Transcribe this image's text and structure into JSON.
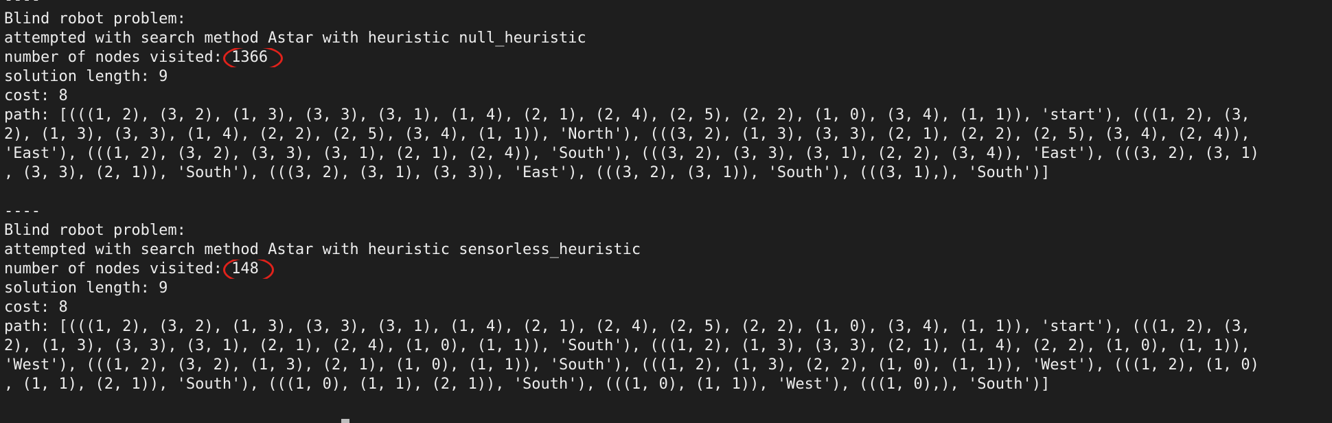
{
  "terminal": {
    "block1": {
      "separator": "----",
      "title": "Blind robot problem:",
      "method_line": "attempted with search method Astar with heuristic null_heuristic",
      "nodes_label": "number of nodes visited: ",
      "nodes_value": "1366",
      "solution_length": "solution length: 9",
      "cost": "cost: 8",
      "path_lines": [
        "path: [(((1, 2), (3, 2), (1, 3), (3, 3), (3, 1), (1, 4), (2, 1), (2, 4), (2, 5), (2, 2), (1, 0), (3, 4), (1, 1)), 'start'), (((1, 2), (3,",
        "2), (1, 3), (3, 3), (1, 4), (2, 2), (2, 5), (3, 4), (1, 1)), 'North'), (((3, 2), (1, 3), (3, 3), (2, 1), (2, 2), (2, 5), (3, 4), (2, 4)),",
        "'East'), (((1, 2), (3, 2), (3, 3), (3, 1), (2, 1), (2, 4)), 'South'), (((3, 2), (3, 3), (3, 1), (2, 2), (3, 4)), 'East'), (((3, 2), (3, 1)",
        ", (3, 3), (2, 1)), 'South'), (((3, 2), (3, 1), (3, 3)), 'East'), (((3, 2), (3, 1)), 'South'), (((3, 1),), 'South')]"
      ]
    },
    "block2": {
      "separator": "----",
      "title": "Blind robot problem:",
      "method_line": "attempted with search method Astar with heuristic sensorless_heuristic",
      "nodes_label": "number of nodes visited: ",
      "nodes_value": "148",
      "solution_length": "solution length: 9",
      "cost": "cost: 8",
      "path_lines": [
        "path: [(((1, 2), (3, 2), (1, 3), (3, 3), (3, 1), (1, 4), (2, 1), (2, 4), (2, 5), (2, 2), (1, 0), (3, 4), (1, 1)), 'start'), (((1, 2), (3,",
        "2), (1, 3), (3, 3), (3, 1), (2, 1), (2, 4), (1, 0), (1, 1)), 'South'), (((1, 2), (1, 3), (3, 3), (2, 1), (1, 4), (2, 2), (1, 0), (1, 1)),",
        "'West'), (((1, 2), (3, 2), (1, 3), (2, 1), (1, 0), (1, 1)), 'South'), (((1, 2), (1, 3), (2, 2), (1, 0), (1, 1)), 'West'), (((1, 2), (1, 0)",
        ", (1, 1), (2, 1)), 'South'), (((1, 0), (1, 1), (2, 1)), 'South'), (((1, 0), (1, 1)), 'West'), (((1, 0),), 'South')]"
      ]
    }
  },
  "colors": {
    "background": "#1e1e1e",
    "text": "#ededed",
    "annotation_circle": "#e0221b"
  }
}
